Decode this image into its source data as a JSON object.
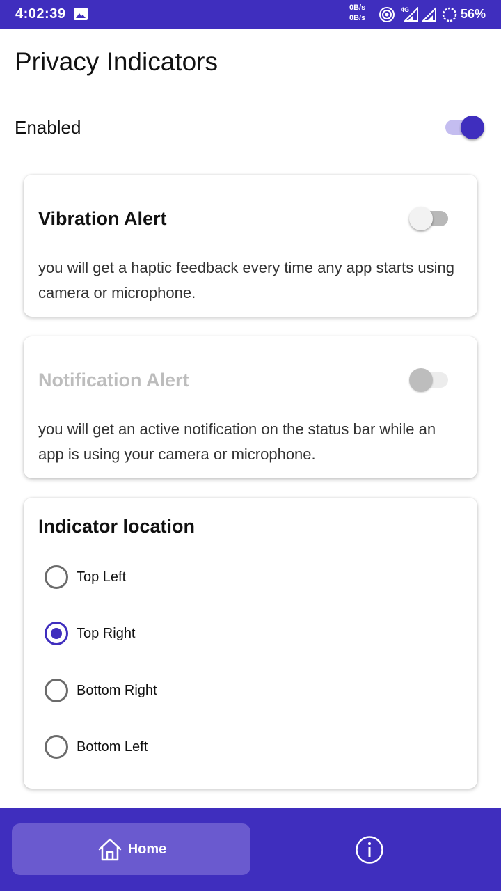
{
  "status_bar": {
    "time": "4:02:39",
    "net_up": "0B/s",
    "net_down": "0B/s",
    "network_type": "4G",
    "battery": "56%",
    "icons": [
      "image-icon",
      "hotspot-icon",
      "signal-icon",
      "signal-icon",
      "battery-icon"
    ]
  },
  "page": {
    "title": "Privacy Indicators",
    "enabled_label": "Enabled",
    "enabled": true
  },
  "vibration_card": {
    "title": "Vibration Alert",
    "description": "you will get a haptic feedback every time any app starts using camera or microphone.",
    "enabled": false
  },
  "notification_card": {
    "title": "Notification Alert",
    "description": "you will get an active notification on the status bar while an app is using your camera or microphone.",
    "enabled": false,
    "disabled": true
  },
  "location_card": {
    "title": "Indicator location",
    "options": [
      {
        "label": "Top Left",
        "selected": false
      },
      {
        "label": "Top Right",
        "selected": true
      },
      {
        "label": "Bottom Right",
        "selected": false
      },
      {
        "label": "Bottom Left",
        "selected": false
      }
    ]
  },
  "bottom_nav": {
    "home_label": "Home",
    "items": [
      "home-icon",
      "info-icon"
    ]
  },
  "colors": {
    "primary": "#3f2ebe",
    "nav_selected": "#6a5acf",
    "switch_track_on": "#c4bdf0"
  }
}
